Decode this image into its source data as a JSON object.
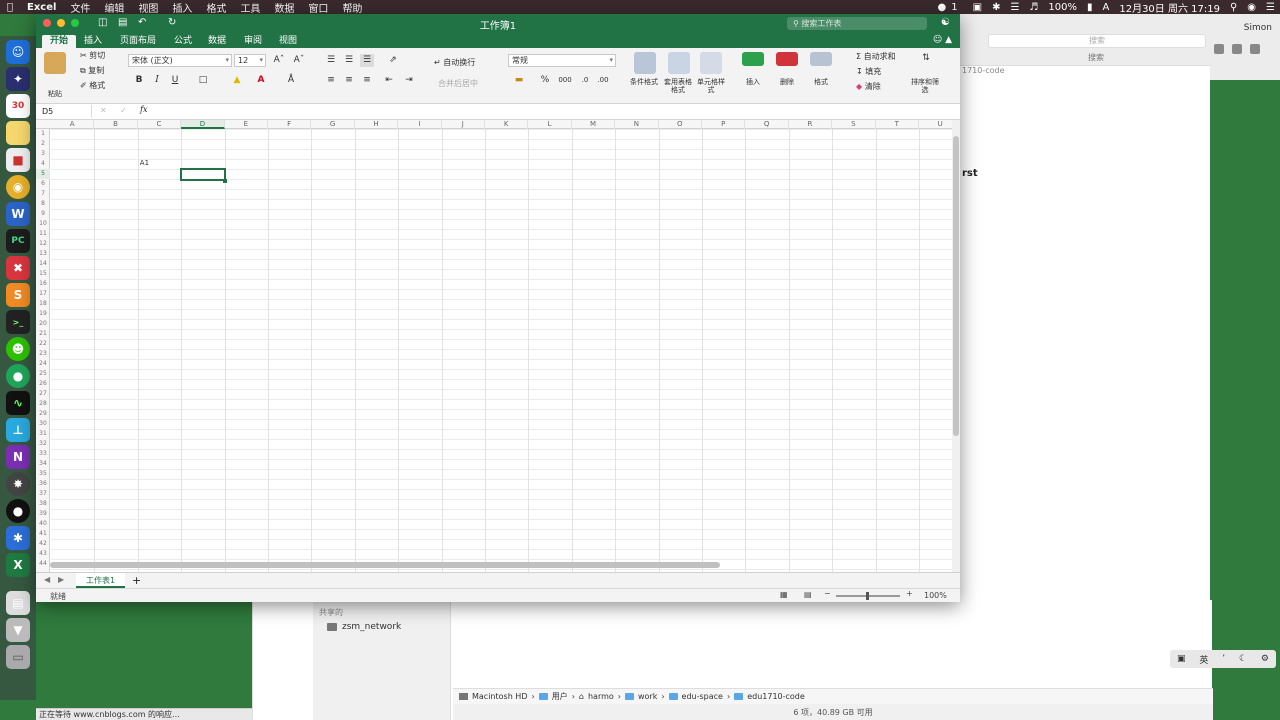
{
  "menubar": {
    "app_name": "Excel",
    "items": [
      "文件",
      "编辑",
      "视图",
      "插入",
      "格式",
      "工具",
      "数据",
      "窗口",
      "帮助"
    ],
    "battery": "100%",
    "input_source": "A",
    "datetime": "12月30日 周六 17:19",
    "notification_count": "1"
  },
  "excel": {
    "title": "工作簿1",
    "search_placeholder": "搜索工作表",
    "tabs": [
      "开始",
      "插入",
      "页面布局",
      "公式",
      "数据",
      "审阅",
      "视图"
    ],
    "active_tab": "开始",
    "clipboard": {
      "paste": "粘贴",
      "cut": "剪切",
      "copy": "复制",
      "format": "格式"
    },
    "font_name": "宋体 (正文)",
    "font_size": "12",
    "wrap_text": "自动换行",
    "merge_center": "合并后居中",
    "number_format": "常规",
    "percent": "%",
    "thousands": "000",
    "styles": {
      "conditional": "条件格式",
      "table": "套用表格格式",
      "cell": "单元格样式"
    },
    "cells_group": {
      "insert": "插入",
      "delete": "删除",
      "format": "格式"
    },
    "editing": {
      "autosum": "自动求和",
      "fill": "填充",
      "clear": "清除",
      "sort": "排序和筛选"
    },
    "name_box": "D5",
    "fx": "fx",
    "columns": [
      "A",
      "B",
      "C",
      "D",
      "E",
      "F",
      "G",
      "H",
      "I",
      "J",
      "K",
      "L",
      "M",
      "N",
      "O",
      "P",
      "Q",
      "R",
      "S",
      "T",
      "U"
    ],
    "selected_column": "D",
    "selected_row": 5,
    "row_count": 44,
    "cell_text": "A1",
    "sheet_tab": "工作表1",
    "add_sheet": "+",
    "status": "就绪",
    "zoom": "100%"
  },
  "finder": {
    "shared_label": "共享的",
    "network_item": "zsm_network",
    "path": [
      "Macintosh HD",
      "用户",
      "harmo",
      "work",
      "edu-space",
      "edu1710-code"
    ],
    "status": "6 项，40.89 GB 可用"
  },
  "rightwin": {
    "search_placeholder": "搜索",
    "search_label": "搜索",
    "path_text": "1710-code",
    "partial_text": "rst",
    "user_name": "Simon"
  },
  "ime": {
    "lang": "英"
  },
  "browser_status": "正在等待 www.cnblogs.com 的响应..."
}
